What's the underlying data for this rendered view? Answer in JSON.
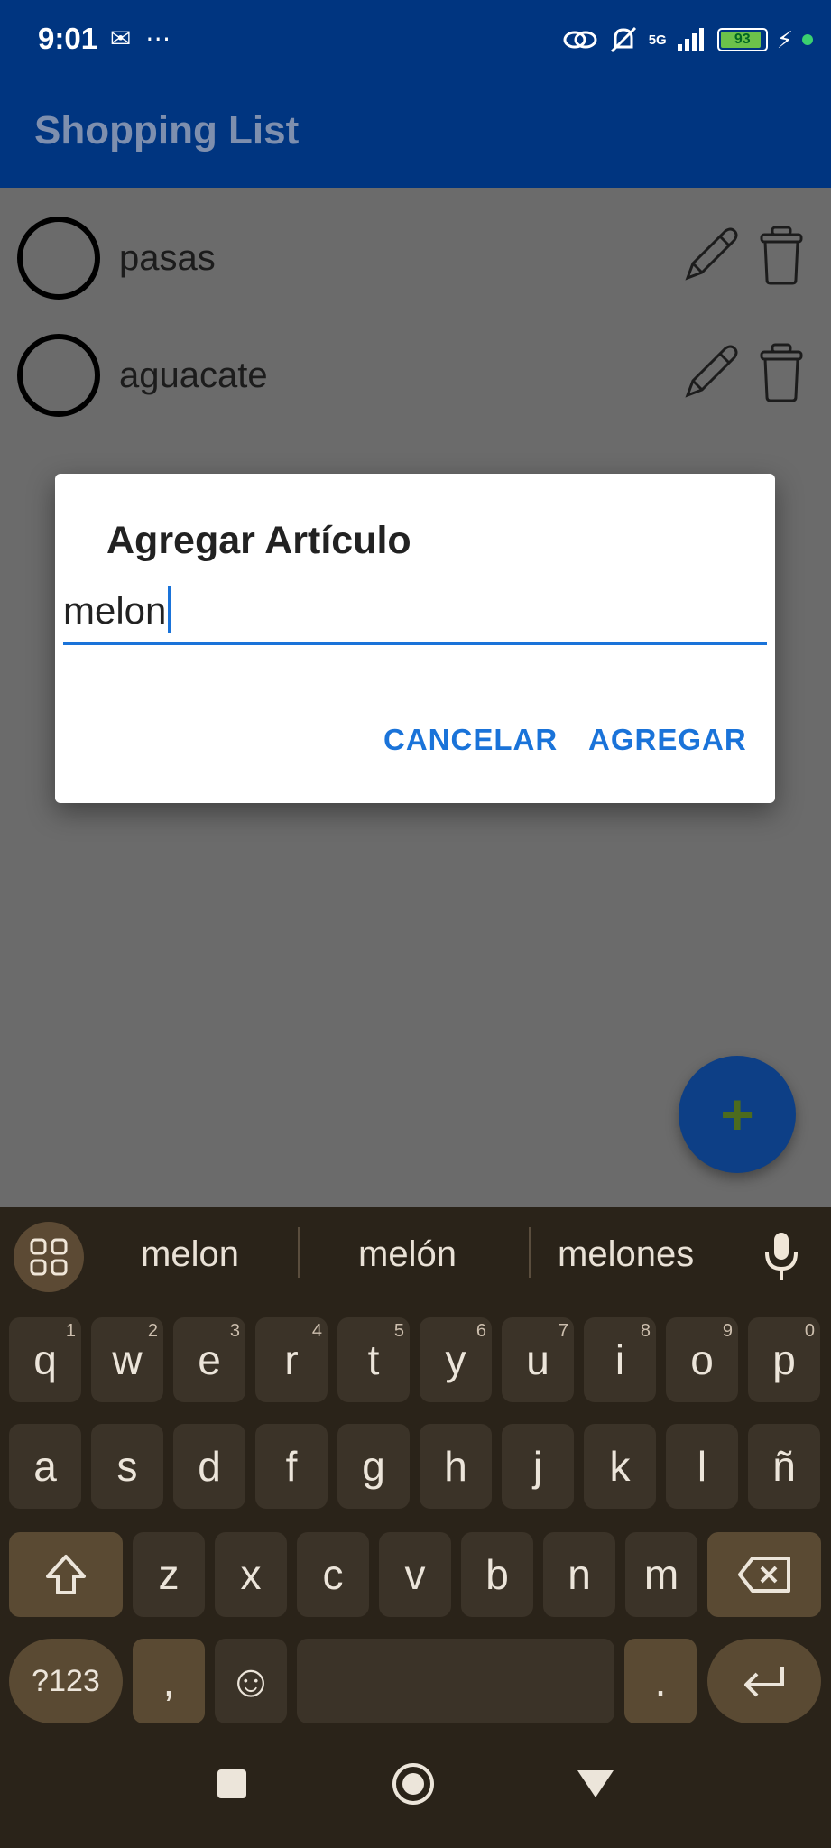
{
  "status_bar": {
    "time": "9:01",
    "left_icons": "✉ ⋯",
    "signal_label": "5G",
    "battery_level": "93",
    "battery_fraction": 0.93
  },
  "app_bar": {
    "title": "Shopping List"
  },
  "items": [
    {
      "label": "pasas"
    },
    {
      "label": "aguacate"
    }
  ],
  "dialog": {
    "title": "Agregar Artículo",
    "input_value": "melon",
    "cancel_label": "CANCELAR",
    "confirm_label": "AGREGAR"
  },
  "fab": {
    "label": "+"
  },
  "keyboard": {
    "suggestions": [
      "melon",
      "melón",
      "melones"
    ],
    "row1": [
      {
        "k": "q",
        "s": "1"
      },
      {
        "k": "w",
        "s": "2"
      },
      {
        "k": "e",
        "s": "3"
      },
      {
        "k": "r",
        "s": "4"
      },
      {
        "k": "t",
        "s": "5"
      },
      {
        "k": "y",
        "s": "6"
      },
      {
        "k": "u",
        "s": "7"
      },
      {
        "k": "i",
        "s": "8"
      },
      {
        "k": "o",
        "s": "9"
      },
      {
        "k": "p",
        "s": "0"
      }
    ],
    "row2": [
      "a",
      "s",
      "d",
      "f",
      "g",
      "h",
      "j",
      "k",
      "l",
      "ñ"
    ],
    "row3": [
      "z",
      "x",
      "c",
      "v",
      "b",
      "n",
      "m"
    ],
    "symbols_label": "?123",
    "comma_label": ",",
    "period_label": ".",
    "emoji": "☺"
  },
  "colors": {
    "app_bar": "#003580",
    "accent": "#1a73d9",
    "keyboard_bg": "#2a2319"
  }
}
